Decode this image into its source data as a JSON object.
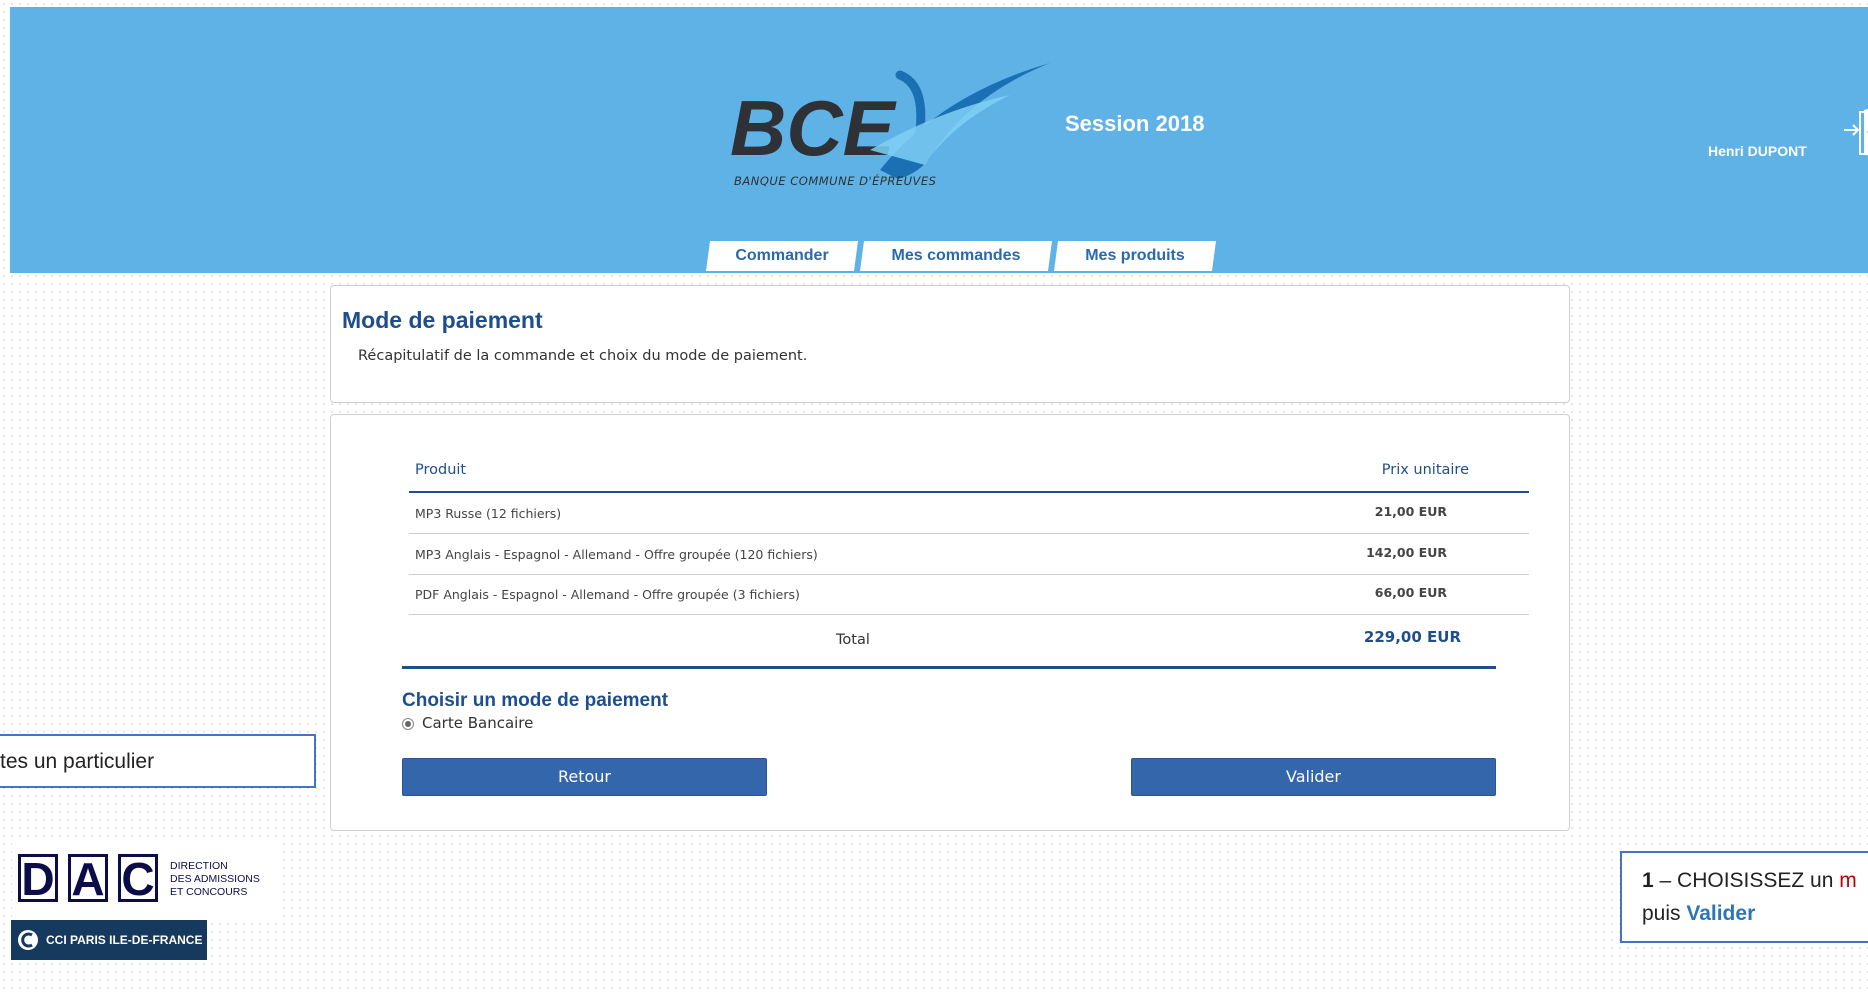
{
  "header": {
    "logo_main": "BCE",
    "logo_sub": "BANQUE COMMUNE D'ÉPREUVES",
    "session": "Session 2018",
    "user_name": "Henri DUPONT"
  },
  "tabs": [
    {
      "label": "Commander"
    },
    {
      "label": "Mes commandes"
    },
    {
      "label": "Mes produits"
    }
  ],
  "intro": {
    "title": "Mode de paiement",
    "description": "Récapitulatif de la commande et choix du mode de paiement."
  },
  "order": {
    "columns": [
      "Produit",
      "Prix unitaire"
    ],
    "rows": [
      {
        "name": "MP3 Russe (12 fichiers)",
        "price": "21,00 EUR"
      },
      {
        "name": "MP3 Anglais - Espagnol - Allemand - Offre groupée (120 fichiers)",
        "price": "142,00 EUR"
      },
      {
        "name": "PDF Anglais - Espagnol - Allemand - Offre groupée (3 fichiers)",
        "price": "66,00 EUR"
      }
    ],
    "total_label": "Total",
    "total_value": "229,00 EUR"
  },
  "payment": {
    "title": "Choisir un mode de paiement",
    "option": "Carte Bancaire",
    "back_label": "Retour",
    "submit_label": "Valider"
  },
  "callouts": {
    "left": "tes un particulier",
    "right_num": "1",
    "right_text": " – CHOISISSEZ un ",
    "right_cut": "m",
    "right_line2": "puis ",
    "right_link": "Valider"
  },
  "footer": {
    "dac_letters": [
      "D",
      "A",
      "C"
    ],
    "dac_line1": "DIRECTION",
    "dac_line2": "DES ADMISSIONS",
    "dac_line3": "ET CONCOURS",
    "cci_label": "CCI PARIS ILE-DE-FRANCE"
  },
  "colors": {
    "header_bg": "#5fb2e5",
    "primary": "#1f4e8c",
    "button": "#3366aa"
  }
}
